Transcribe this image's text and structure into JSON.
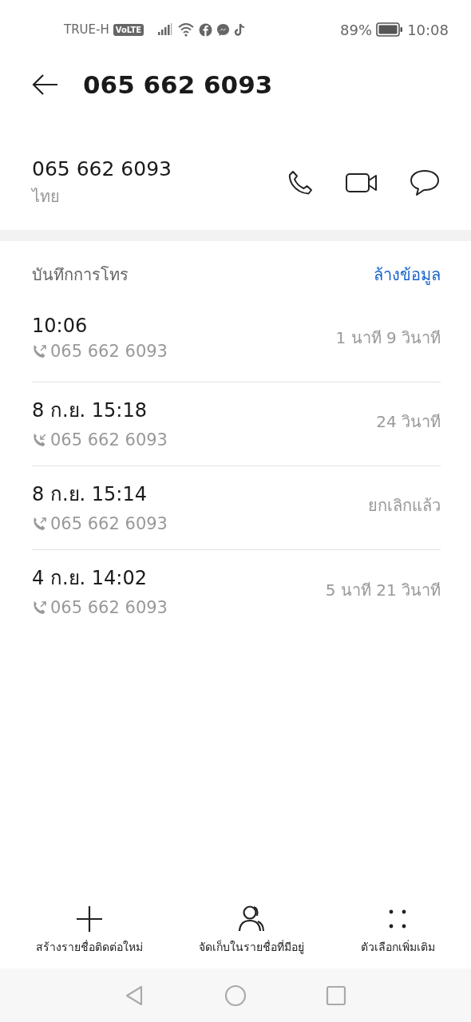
{
  "status_bar": {
    "carrier": "TRUE-H",
    "volte": "VoLTE",
    "battery_percent": "89%",
    "time": "10:08"
  },
  "header": {
    "title": "065 662 6093"
  },
  "contact": {
    "number": "065 662 6093",
    "region": "ไทย"
  },
  "call_log": {
    "title": "บันทึกการโทร",
    "clear_label": "ล้างข้อมูล",
    "entries": [
      {
        "time": "10:06",
        "kind": "outgoing",
        "number": "065 662 6093",
        "duration": "1 นาที 9 วินาที"
      },
      {
        "time": "8 ก.ย. 15:18",
        "kind": "incoming",
        "number": "065 662 6093",
        "duration": "24 วินาที"
      },
      {
        "time": "8 ก.ย. 15:14",
        "kind": "outgoing",
        "number": "065 662 6093",
        "duration": "ยกเลิกแล้ว"
      },
      {
        "time": "4 ก.ย. 14:02",
        "kind": "outgoing",
        "number": "065 662 6093",
        "duration": "5 นาที 21 วินาที"
      }
    ]
  },
  "actions": [
    {
      "kind": "add",
      "label": "สร้างรายชื่อติดต่อใหม่"
    },
    {
      "kind": "person",
      "label": "จัดเก็บในรายชื่อที่มีอยู่"
    },
    {
      "kind": "more",
      "label": "ตัวเลือกเพิ่มเติม"
    }
  ]
}
